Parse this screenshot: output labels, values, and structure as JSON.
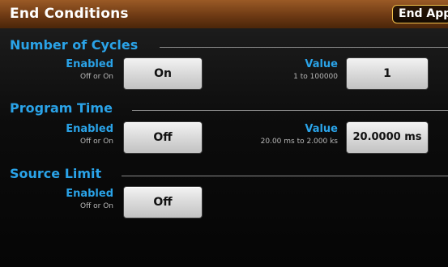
{
  "header": {
    "title": "End Conditions",
    "end_app_label": "End App"
  },
  "sections": {
    "cycles": {
      "title": "Number of Cycles",
      "enabled_label": "Enabled",
      "enabled_hint": "Off or On",
      "enabled_value": "On",
      "value_label": "Value",
      "value_hint": "1 to 100000",
      "value": "1"
    },
    "program_time": {
      "title": "Program Time",
      "enabled_label": "Enabled",
      "enabled_hint": "Off or On",
      "enabled_value": "Off",
      "value_label": "Value",
      "value_hint": "20.00 ms to 2.000 ks",
      "value": "20.0000 ms"
    },
    "source_limit": {
      "title": "Source Limit",
      "enabled_label": "Enabled",
      "enabled_hint": "Off or On",
      "enabled_value": "Off"
    }
  },
  "colors": {
    "accent": "#2aa3e8",
    "header_brown": "#6e3a14",
    "end_app_border": "#f2c14a"
  }
}
